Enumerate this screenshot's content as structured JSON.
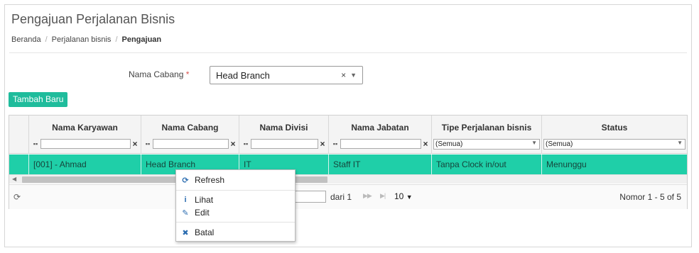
{
  "page": {
    "title": "Pengajuan Perjalanan Bisnis",
    "breadcrumb": [
      "Beranda",
      "Perjalanan bisnis",
      "Pengajuan"
    ]
  },
  "form": {
    "branch_label": "Nama Cabang",
    "required_mark": "*",
    "branch_value": "Head Branch"
  },
  "toolbar": {
    "add_label": "Tambah Baru"
  },
  "grid": {
    "columns": [
      "Nama Karyawan",
      "Nama Cabang",
      "Nama Divisi",
      "Nama Jabatan",
      "Tipe Perjalanan bisnis",
      "Status"
    ],
    "filter_select_value": "(Semua)",
    "rows": [
      [
        "[001] - Ahmad",
        "Head Branch",
        "IT",
        "Staff IT",
        "Tanpa Clock in/out",
        "Menunggu"
      ]
    ]
  },
  "pager": {
    "of_text": "dari 1",
    "page_size": "10",
    "summary": "Nomor 1 - 5 of 5"
  },
  "context_menu": {
    "refresh": "Refresh",
    "view": "Lihat",
    "edit": "Edit",
    "cancel": "Batal"
  },
  "colors": {
    "accent": "#1fbc9c",
    "selected_row": "#1fcfa8"
  }
}
